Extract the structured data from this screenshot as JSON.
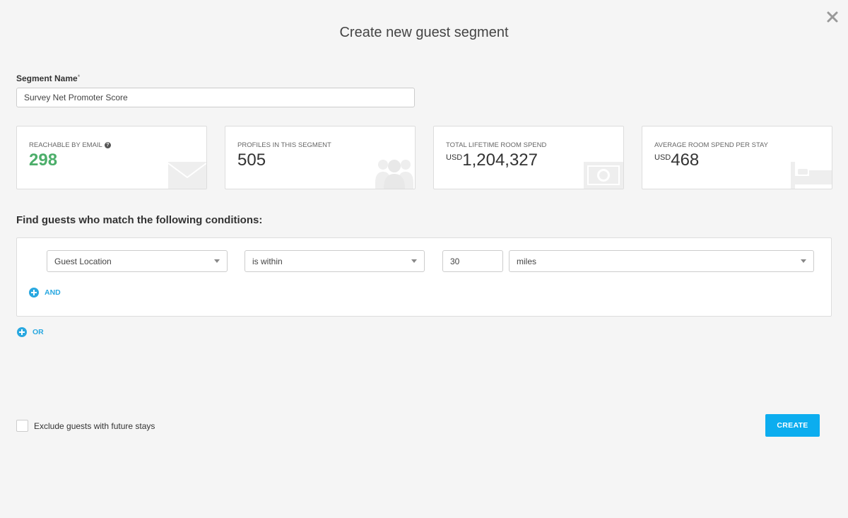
{
  "dialog": {
    "title": "Create new guest segment",
    "close_icon": "close-icon"
  },
  "segment_name": {
    "label": "Segment Name",
    "required_mark": "*",
    "value": "Survey Net Promoter Score"
  },
  "stats": [
    {
      "label": "Reachable by Email",
      "value": "298",
      "currency": "",
      "icon": "envelope-icon",
      "color": "#4cae6a"
    },
    {
      "label": "Profiles in this Segment",
      "value": "505",
      "currency": "",
      "icon": "people-icon"
    },
    {
      "label": "Total Lifetime Room Spend",
      "value": "1,204,327",
      "currency": "USD",
      "icon": "banknote-icon"
    },
    {
      "label": "Average Room Spend per Stay",
      "value": "468",
      "currency": "USD",
      "icon": "bed-icon"
    }
  ],
  "conditions": {
    "heading": "Find guests who match the following conditions:",
    "rows": [
      {
        "field": "Guest Location",
        "operator": "is within",
        "amount": "30",
        "unit": "miles"
      }
    ],
    "and_label": "AND",
    "or_label": "OR"
  },
  "footer": {
    "exclude_label": "Exclude guests with future stays",
    "exclude_checked": false,
    "create_label": "CREATE"
  },
  "colors": {
    "accent": "#29a8e0",
    "create_button": "#0cadef",
    "reachable_value": "#4cae6a"
  }
}
